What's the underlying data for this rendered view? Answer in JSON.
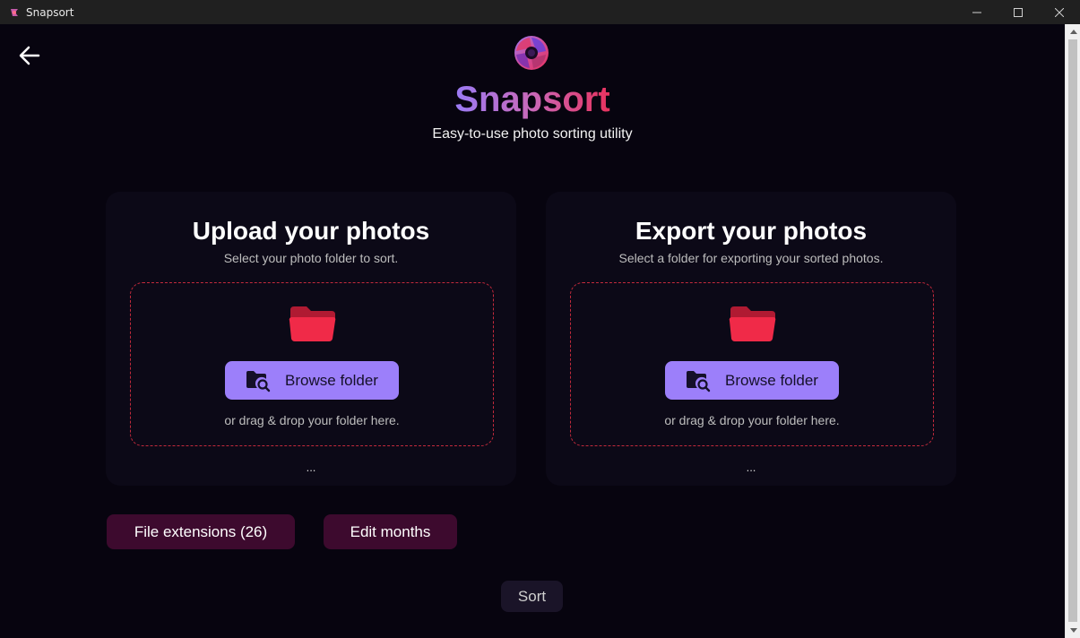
{
  "window": {
    "title": "Snapsort"
  },
  "header": {
    "app_name": "Snapsort",
    "tagline": "Easy-to-use photo sorting utility"
  },
  "upload_card": {
    "title": "Upload your photos",
    "subtitle": "Select your photo folder to sort.",
    "browse_label": "Browse folder",
    "drag_hint": "or drag & drop your folder here.",
    "selected_path": "..."
  },
  "export_card": {
    "title": "Export your photos",
    "subtitle": "Select a folder for exporting your sorted photos.",
    "browse_label": "Browse folder",
    "drag_hint": "or drag & drop your folder here.",
    "selected_path": "..."
  },
  "options": {
    "file_extensions_label": "File extensions (26)",
    "edit_months_label": "Edit months"
  },
  "actions": {
    "sort_label": "Sort"
  },
  "icons": {
    "back": "arrow-left-icon",
    "folder": "folder-icon",
    "browse": "folder-search-icon"
  },
  "colors": {
    "background": "#07040f",
    "card": "#0c0917",
    "accent_purple": "#9c7ffa",
    "accent_red": "#e8325e",
    "pill_button": "#3d0a2e",
    "dropzone_border": "#c42a3c"
  }
}
